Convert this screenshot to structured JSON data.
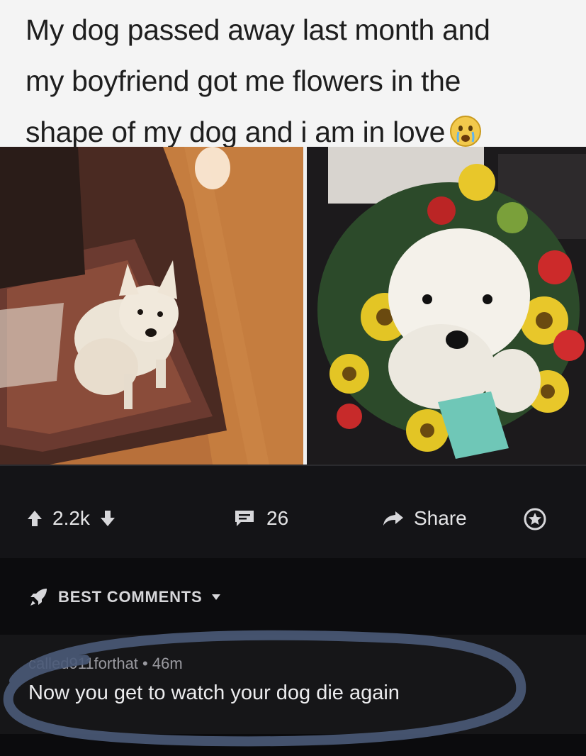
{
  "post": {
    "title_lines": [
      "My dog passed away last month and",
      "my boyfriend got me flowers in the",
      "shape of my dog and i am in love"
    ],
    "title_emoji": "crying-face-icon"
  },
  "images": {
    "left": "photo of white terrier dog on rug",
    "right": "flower arrangement shaped like dog"
  },
  "actions": {
    "vote_count": "2.2k",
    "comment_count": "26",
    "share_label": "Share"
  },
  "comments_section": {
    "sort_label": "BEST COMMENTS"
  },
  "comment": {
    "author": "called911forthat",
    "separator": "•",
    "age": "46m",
    "meta": "called911forthat • 46m",
    "body": "Now you get to watch your dog die again"
  },
  "colors": {
    "header_bg": "#f4f4f4",
    "dark_bg": "#141417",
    "scribble": "#4a5a78"
  }
}
